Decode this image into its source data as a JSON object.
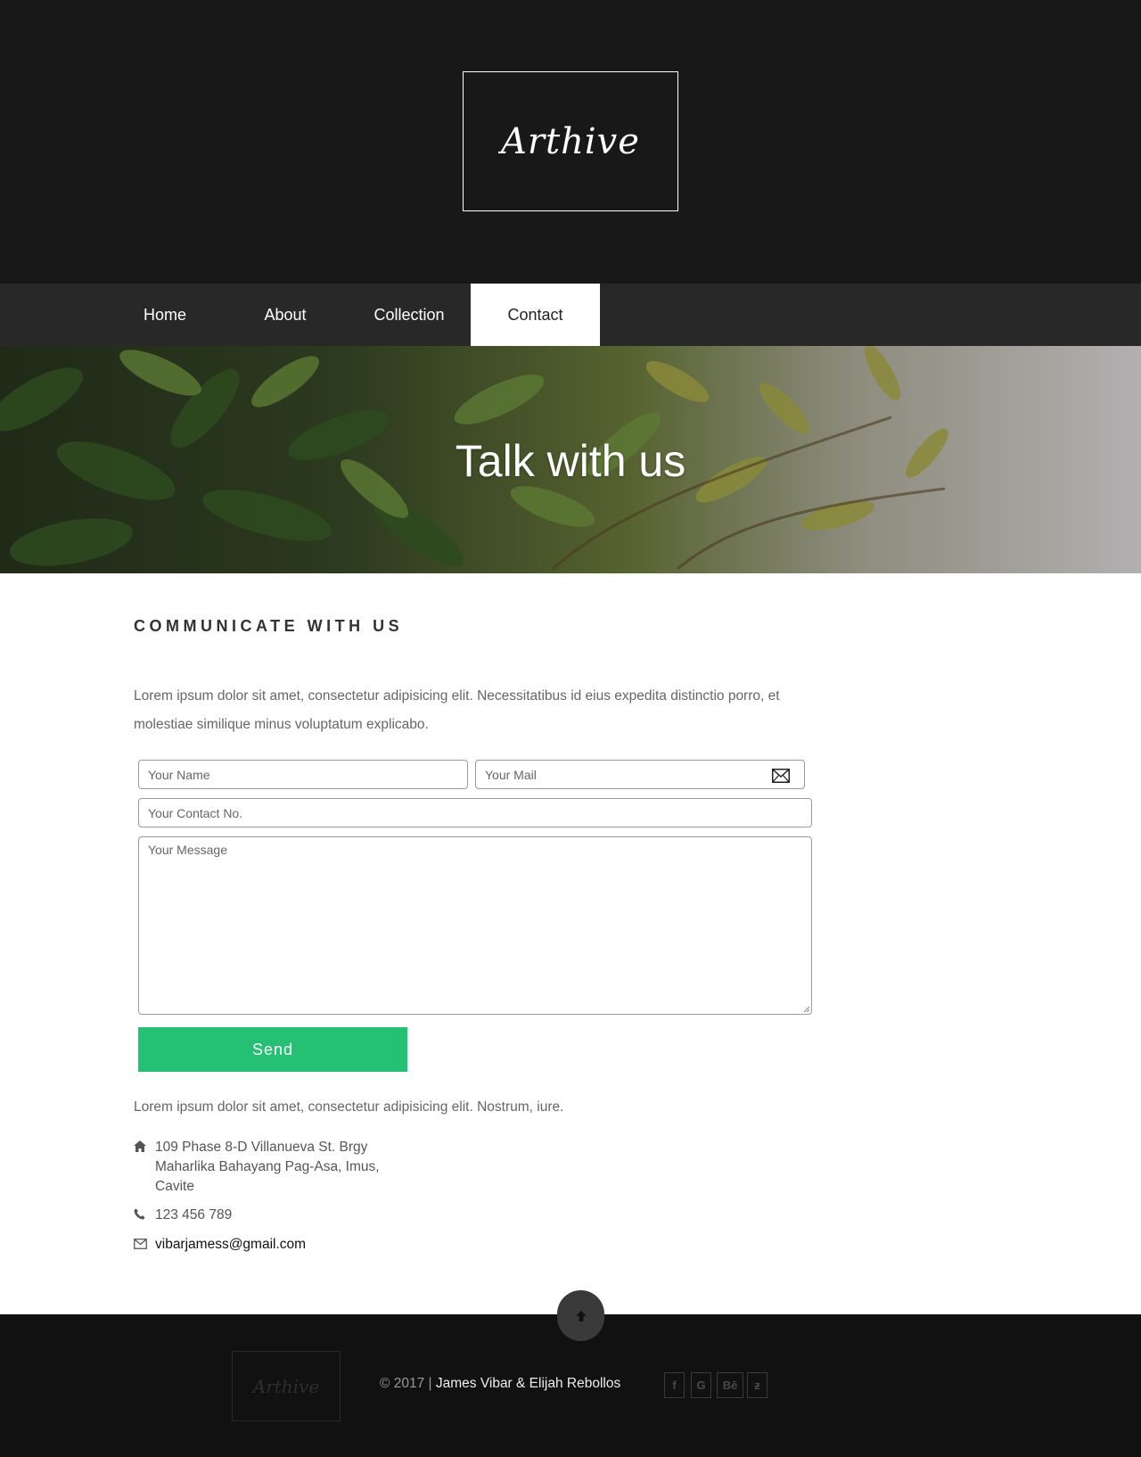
{
  "brand": {
    "name": "Arthive"
  },
  "nav": {
    "items": [
      {
        "label": "Home"
      },
      {
        "label": "About"
      },
      {
        "label": "Collection"
      },
      {
        "label": "Contact"
      }
    ],
    "active": "Contact"
  },
  "hero": {
    "title": "Talk with us"
  },
  "contact": {
    "heading": "COMMUNICATE WITH US",
    "intro": "Lorem ipsum dolor sit amet, consectetur adipisicing elit. Necessitatibus id eius expedita distinctio porro, et molestiae similique minus voluptatum explicabo.",
    "form": {
      "name_placeholder": "Your Name",
      "mail_placeholder": "Your Mail",
      "contact_placeholder": "Your Contact No.",
      "message_placeholder": "Your Message",
      "send_label": "Send"
    },
    "note": "Lorem ipsum dolor sit amet, consectetur adipisicing elit. Nostrum, iure.",
    "address_lines": [
      "109 Phase 8-D Villanueva St. Brgy",
      "Maharlika Bahayang Pag-Asa, Imus,",
      "Cavite"
    ],
    "phone": "123 456 789",
    "email": "vibarjamess@gmail.com"
  },
  "footer": {
    "logo": "Arthive",
    "copyright_prefix": "© 2017 |",
    "authors": "James Vibar & Elijah Rebollos",
    "social": [
      {
        "icon": "facebook-icon",
        "glyph": "f"
      },
      {
        "icon": "google-icon",
        "glyph": "G"
      },
      {
        "icon": "behance-icon",
        "glyph": "Bē"
      },
      {
        "icon": "deviantart-icon",
        "glyph": "ƶ"
      }
    ]
  },
  "colors": {
    "header_bg": "#181818",
    "nav_bg": "#282828",
    "accent_green": "#25c073",
    "footer_bg": "#111111"
  }
}
